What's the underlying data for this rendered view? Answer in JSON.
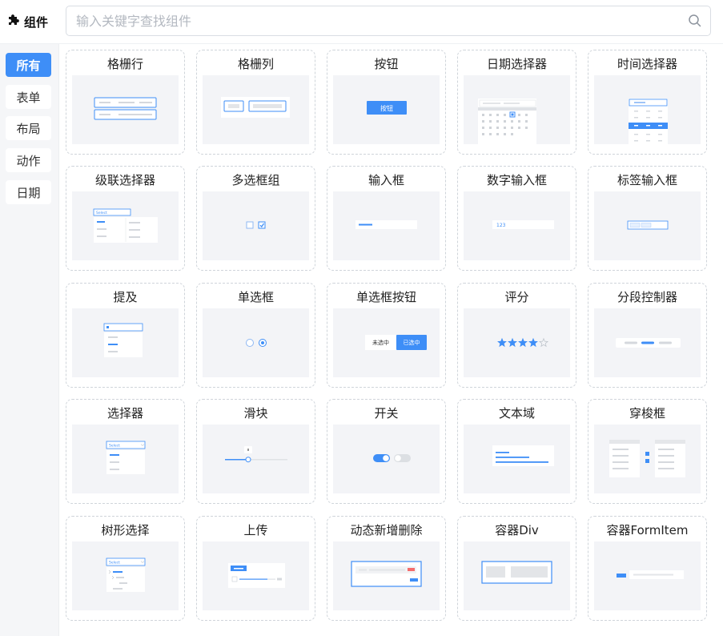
{
  "header": {
    "title": "组件",
    "search_placeholder": "输入关键字查找组件"
  },
  "sidebar": {
    "items": [
      {
        "label": "所有",
        "active": true
      },
      {
        "label": "表单",
        "active": false
      },
      {
        "label": "布局",
        "active": false
      },
      {
        "label": "动作",
        "active": false
      },
      {
        "label": "日期",
        "active": false
      }
    ]
  },
  "components": [
    {
      "title": "格栅行",
      "preview": "row-preview"
    },
    {
      "title": "格栅列",
      "preview": "col-preview"
    },
    {
      "title": "按钮",
      "preview": "button-preview",
      "text": "按钮"
    },
    {
      "title": "日期选择器",
      "preview": "date-picker-preview"
    },
    {
      "title": "时间选择器",
      "preview": "time-picker-preview"
    },
    {
      "title": "级联选择器",
      "preview": "cascader-preview",
      "text": "Select"
    },
    {
      "title": "多选框组",
      "preview": "checkbox-group-preview"
    },
    {
      "title": "输入框",
      "preview": "input-preview"
    },
    {
      "title": "数字输入框",
      "preview": "number-input-preview",
      "text": "123"
    },
    {
      "title": "标签输入框",
      "preview": "tag-input-preview"
    },
    {
      "title": "提及",
      "preview": "mention-preview"
    },
    {
      "title": "单选框",
      "preview": "radio-preview"
    },
    {
      "title": "单选框按钮",
      "preview": "radio-button-preview",
      "opt1": "未选中",
      "opt2": "已选中"
    },
    {
      "title": "评分",
      "preview": "rate-preview",
      "rating": 4,
      "max": 5
    },
    {
      "title": "分段控制器",
      "preview": "segmented-preview"
    },
    {
      "title": "选择器",
      "preview": "select-preview",
      "text": "Select"
    },
    {
      "title": "滑块",
      "preview": "slider-preview"
    },
    {
      "title": "开关",
      "preview": "switch-preview"
    },
    {
      "title": "文本域",
      "preview": "textarea-preview"
    },
    {
      "title": "穿梭框",
      "preview": "transfer-preview"
    },
    {
      "title": "树形选择",
      "preview": "tree-select-preview",
      "text": "Select"
    },
    {
      "title": "上传",
      "preview": "upload-preview"
    },
    {
      "title": "动态新增删除",
      "preview": "dynamic-list-preview"
    },
    {
      "title": "容器Div",
      "preview": "div-container-preview"
    },
    {
      "title": "容器FormItem",
      "preview": "form-item-container-preview"
    }
  ],
  "colors": {
    "accent": "#3e8ef7",
    "preview_bg": "#f3f4f7",
    "star": "#3e8ef7"
  }
}
